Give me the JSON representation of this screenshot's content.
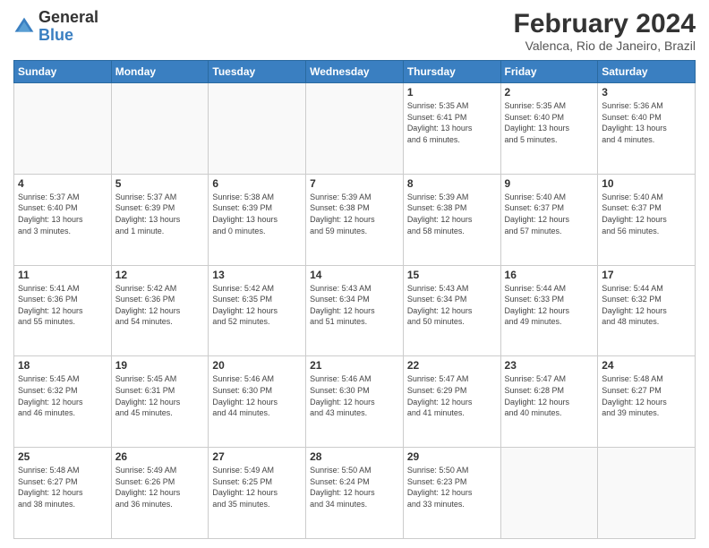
{
  "header": {
    "logo": {
      "line1": "General",
      "line2": "Blue"
    },
    "title": "February 2024",
    "location": "Valenca, Rio de Janeiro, Brazil"
  },
  "days_of_week": [
    "Sunday",
    "Monday",
    "Tuesday",
    "Wednesday",
    "Thursday",
    "Friday",
    "Saturday"
  ],
  "weeks": [
    [
      {
        "day": "",
        "info": ""
      },
      {
        "day": "",
        "info": ""
      },
      {
        "day": "",
        "info": ""
      },
      {
        "day": "",
        "info": ""
      },
      {
        "day": "1",
        "info": "Sunrise: 5:35 AM\nSunset: 6:41 PM\nDaylight: 13 hours\nand 6 minutes."
      },
      {
        "day": "2",
        "info": "Sunrise: 5:35 AM\nSunset: 6:40 PM\nDaylight: 13 hours\nand 5 minutes."
      },
      {
        "day": "3",
        "info": "Sunrise: 5:36 AM\nSunset: 6:40 PM\nDaylight: 13 hours\nand 4 minutes."
      }
    ],
    [
      {
        "day": "4",
        "info": "Sunrise: 5:37 AM\nSunset: 6:40 PM\nDaylight: 13 hours\nand 3 minutes."
      },
      {
        "day": "5",
        "info": "Sunrise: 5:37 AM\nSunset: 6:39 PM\nDaylight: 13 hours\nand 1 minute."
      },
      {
        "day": "6",
        "info": "Sunrise: 5:38 AM\nSunset: 6:39 PM\nDaylight: 13 hours\nand 0 minutes."
      },
      {
        "day": "7",
        "info": "Sunrise: 5:39 AM\nSunset: 6:38 PM\nDaylight: 12 hours\nand 59 minutes."
      },
      {
        "day": "8",
        "info": "Sunrise: 5:39 AM\nSunset: 6:38 PM\nDaylight: 12 hours\nand 58 minutes."
      },
      {
        "day": "9",
        "info": "Sunrise: 5:40 AM\nSunset: 6:37 PM\nDaylight: 12 hours\nand 57 minutes."
      },
      {
        "day": "10",
        "info": "Sunrise: 5:40 AM\nSunset: 6:37 PM\nDaylight: 12 hours\nand 56 minutes."
      }
    ],
    [
      {
        "day": "11",
        "info": "Sunrise: 5:41 AM\nSunset: 6:36 PM\nDaylight: 12 hours\nand 55 minutes."
      },
      {
        "day": "12",
        "info": "Sunrise: 5:42 AM\nSunset: 6:36 PM\nDaylight: 12 hours\nand 54 minutes."
      },
      {
        "day": "13",
        "info": "Sunrise: 5:42 AM\nSunset: 6:35 PM\nDaylight: 12 hours\nand 52 minutes."
      },
      {
        "day": "14",
        "info": "Sunrise: 5:43 AM\nSunset: 6:34 PM\nDaylight: 12 hours\nand 51 minutes."
      },
      {
        "day": "15",
        "info": "Sunrise: 5:43 AM\nSunset: 6:34 PM\nDaylight: 12 hours\nand 50 minutes."
      },
      {
        "day": "16",
        "info": "Sunrise: 5:44 AM\nSunset: 6:33 PM\nDaylight: 12 hours\nand 49 minutes."
      },
      {
        "day": "17",
        "info": "Sunrise: 5:44 AM\nSunset: 6:32 PM\nDaylight: 12 hours\nand 48 minutes."
      }
    ],
    [
      {
        "day": "18",
        "info": "Sunrise: 5:45 AM\nSunset: 6:32 PM\nDaylight: 12 hours\nand 46 minutes."
      },
      {
        "day": "19",
        "info": "Sunrise: 5:45 AM\nSunset: 6:31 PM\nDaylight: 12 hours\nand 45 minutes."
      },
      {
        "day": "20",
        "info": "Sunrise: 5:46 AM\nSunset: 6:30 PM\nDaylight: 12 hours\nand 44 minutes."
      },
      {
        "day": "21",
        "info": "Sunrise: 5:46 AM\nSunset: 6:30 PM\nDaylight: 12 hours\nand 43 minutes."
      },
      {
        "day": "22",
        "info": "Sunrise: 5:47 AM\nSunset: 6:29 PM\nDaylight: 12 hours\nand 41 minutes."
      },
      {
        "day": "23",
        "info": "Sunrise: 5:47 AM\nSunset: 6:28 PM\nDaylight: 12 hours\nand 40 minutes."
      },
      {
        "day": "24",
        "info": "Sunrise: 5:48 AM\nSunset: 6:27 PM\nDaylight: 12 hours\nand 39 minutes."
      }
    ],
    [
      {
        "day": "25",
        "info": "Sunrise: 5:48 AM\nSunset: 6:27 PM\nDaylight: 12 hours\nand 38 minutes."
      },
      {
        "day": "26",
        "info": "Sunrise: 5:49 AM\nSunset: 6:26 PM\nDaylight: 12 hours\nand 36 minutes."
      },
      {
        "day": "27",
        "info": "Sunrise: 5:49 AM\nSunset: 6:25 PM\nDaylight: 12 hours\nand 35 minutes."
      },
      {
        "day": "28",
        "info": "Sunrise: 5:50 AM\nSunset: 6:24 PM\nDaylight: 12 hours\nand 34 minutes."
      },
      {
        "day": "29",
        "info": "Sunrise: 5:50 AM\nSunset: 6:23 PM\nDaylight: 12 hours\nand 33 minutes."
      },
      {
        "day": "",
        "info": ""
      },
      {
        "day": "",
        "info": ""
      }
    ]
  ]
}
